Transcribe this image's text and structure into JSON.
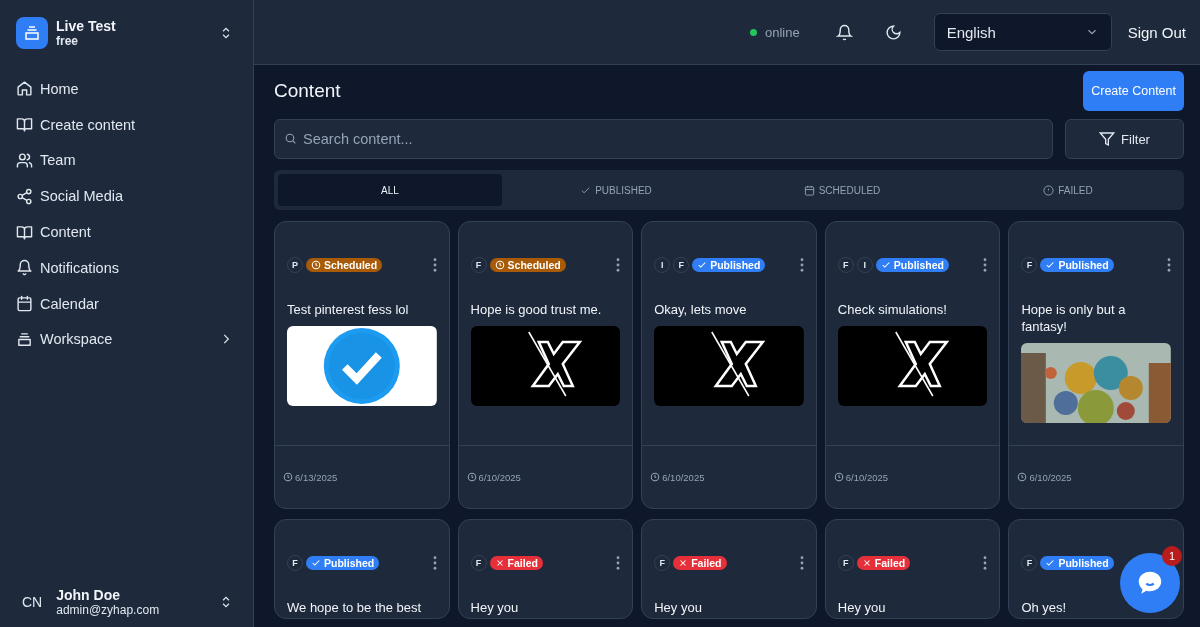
{
  "workspace": {
    "name": "Live Test",
    "plan": "free"
  },
  "sidebar": {
    "items": [
      {
        "label": "Home"
      },
      {
        "label": "Create content"
      },
      {
        "label": "Team"
      },
      {
        "label": "Social Media"
      },
      {
        "label": "Content"
      },
      {
        "label": "Notifications"
      },
      {
        "label": "Calendar"
      },
      {
        "label": "Workspace",
        "expandable": true
      }
    ]
  },
  "user": {
    "initials": "CN",
    "name": "John Doe",
    "email": "admin@zyhap.com"
  },
  "header": {
    "status": "online",
    "language": "English",
    "sign_out": "Sign Out"
  },
  "page": {
    "title": "Content",
    "create_button": "Create Content",
    "search": {
      "placeholder": "Search content..."
    },
    "filter_button": "Filter"
  },
  "tabs": [
    {
      "label": "ALL",
      "selected": true
    },
    {
      "label": "PUBLISHED",
      "selected": false
    },
    {
      "label": "SCHEDULED",
      "selected": false
    },
    {
      "label": "FAILED",
      "selected": false
    }
  ],
  "cards": [
    {
      "platforms": [
        "P"
      ],
      "status": {
        "kind": "scheduled",
        "label": "Scheduled"
      },
      "text": "Test pinterest fess lol",
      "picture": true,
      "date": "6/13/2025"
    },
    {
      "platforms": [
        "F"
      ],
      "status": {
        "kind": "scheduled",
        "label": "Scheduled"
      },
      "text": "Hope is good trust me.",
      "picture": true,
      "date": "6/10/2025"
    },
    {
      "platforms": [
        "I",
        "F"
      ],
      "status": {
        "kind": "published",
        "label": "Published"
      },
      "text": "Okay, lets move",
      "picture": true,
      "date": "6/10/2025"
    },
    {
      "platforms": [
        "F",
        "I"
      ],
      "status": {
        "kind": "published",
        "label": "Published"
      },
      "text": "Check simulations!",
      "picture": true,
      "date": "6/10/2025"
    },
    {
      "platforms": [
        "F"
      ],
      "status": {
        "kind": "published",
        "label": "Published"
      },
      "text": "Hope is only but a fantasy!",
      "picture": true,
      "date": "6/10/2025"
    },
    {
      "platforms": [
        "F"
      ],
      "status": {
        "kind": "published",
        "label": "Published"
      },
      "text": "We hope to be the best"
    },
    {
      "platforms": [
        "F"
      ],
      "status": {
        "kind": "failed",
        "label": "Failed"
      },
      "text": "Hey you"
    },
    {
      "platforms": [
        "F"
      ],
      "status": {
        "kind": "failed",
        "label": "Failed"
      },
      "text": "Hey you"
    },
    {
      "platforms": [
        "F"
      ],
      "status": {
        "kind": "failed",
        "label": "Failed"
      },
      "text": "Hey you"
    },
    {
      "platforms": [
        "F"
      ],
      "status": {
        "kind": "published",
        "label": "Published"
      },
      "text": "Oh yes!"
    }
  ],
  "chat": {
    "badge": "1"
  }
}
